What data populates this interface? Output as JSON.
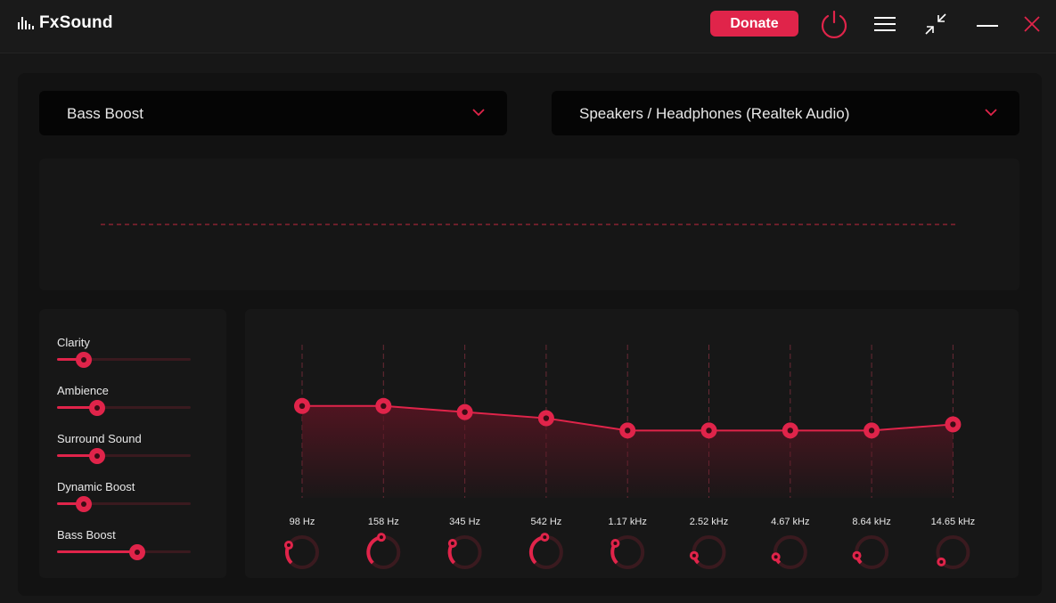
{
  "app": {
    "title": "FxSound",
    "donate_label": "Donate",
    "accent_color": "#e0244a",
    "icons": [
      "power-icon",
      "menu-icon",
      "minimize-view-icon",
      "minimize-icon",
      "close-icon"
    ]
  },
  "preset": {
    "selected": "Bass Boost"
  },
  "output_device": {
    "selected": "Speakers / Headphones (Realtek Audio)"
  },
  "effects": [
    {
      "label": "Clarity",
      "value": 0.2
    },
    {
      "label": "Ambience",
      "value": 0.3
    },
    {
      "label": "Surround Sound",
      "value": 0.3
    },
    {
      "label": "Dynamic Boost",
      "value": 0.2
    },
    {
      "label": "Bass Boost",
      "value": 0.6
    }
  ],
  "equalizer": {
    "bands": [
      {
        "label": "98 Hz",
        "level": 0.6
      },
      {
        "label": "158 Hz",
        "level": 0.6
      },
      {
        "label": "345 Hz",
        "level": 0.56
      },
      {
        "label": "542 Hz",
        "level": 0.52
      },
      {
        "label": "1.17 kHz",
        "level": 0.44
      },
      {
        "label": "2.52 kHz",
        "level": 0.44
      },
      {
        "label": "4.67 kHz",
        "level": 0.44
      },
      {
        "label": "8.64 kHz",
        "level": 0.44
      },
      {
        "label": "14.65 kHz",
        "level": 0.48
      }
    ],
    "knob_values": [
      0.27,
      0.47,
      0.3,
      0.48,
      0.3,
      0.12,
      0.1,
      0.12,
      0.02
    ]
  }
}
